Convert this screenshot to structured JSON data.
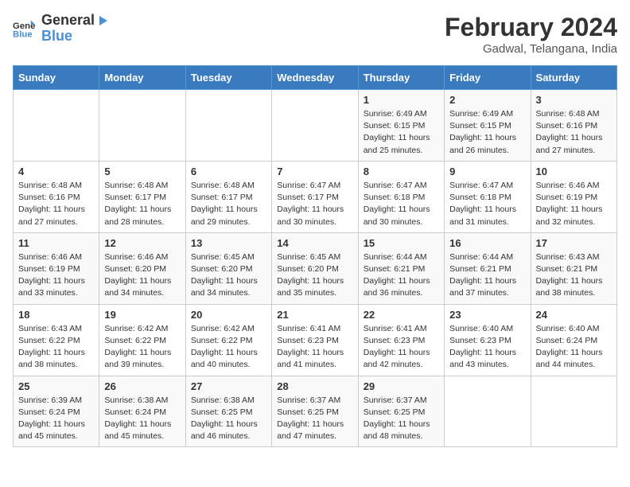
{
  "header": {
    "logo_general": "General",
    "logo_blue": "Blue",
    "title": "February 2024",
    "location": "Gadwal, Telangana, India"
  },
  "days_of_week": [
    "Sunday",
    "Monday",
    "Tuesday",
    "Wednesday",
    "Thursday",
    "Friday",
    "Saturday"
  ],
  "weeks": [
    [
      {
        "day": "",
        "info": ""
      },
      {
        "day": "",
        "info": ""
      },
      {
        "day": "",
        "info": ""
      },
      {
        "day": "",
        "info": ""
      },
      {
        "day": "1",
        "info": "Sunrise: 6:49 AM\nSunset: 6:15 PM\nDaylight: 11 hours and 25 minutes."
      },
      {
        "day": "2",
        "info": "Sunrise: 6:49 AM\nSunset: 6:15 PM\nDaylight: 11 hours and 26 minutes."
      },
      {
        "day": "3",
        "info": "Sunrise: 6:48 AM\nSunset: 6:16 PM\nDaylight: 11 hours and 27 minutes."
      }
    ],
    [
      {
        "day": "4",
        "info": "Sunrise: 6:48 AM\nSunset: 6:16 PM\nDaylight: 11 hours and 27 minutes."
      },
      {
        "day": "5",
        "info": "Sunrise: 6:48 AM\nSunset: 6:17 PM\nDaylight: 11 hours and 28 minutes."
      },
      {
        "day": "6",
        "info": "Sunrise: 6:48 AM\nSunset: 6:17 PM\nDaylight: 11 hours and 29 minutes."
      },
      {
        "day": "7",
        "info": "Sunrise: 6:47 AM\nSunset: 6:17 PM\nDaylight: 11 hours and 30 minutes."
      },
      {
        "day": "8",
        "info": "Sunrise: 6:47 AM\nSunset: 6:18 PM\nDaylight: 11 hours and 30 minutes."
      },
      {
        "day": "9",
        "info": "Sunrise: 6:47 AM\nSunset: 6:18 PM\nDaylight: 11 hours and 31 minutes."
      },
      {
        "day": "10",
        "info": "Sunrise: 6:46 AM\nSunset: 6:19 PM\nDaylight: 11 hours and 32 minutes."
      }
    ],
    [
      {
        "day": "11",
        "info": "Sunrise: 6:46 AM\nSunset: 6:19 PM\nDaylight: 11 hours and 33 minutes."
      },
      {
        "day": "12",
        "info": "Sunrise: 6:46 AM\nSunset: 6:20 PM\nDaylight: 11 hours and 34 minutes."
      },
      {
        "day": "13",
        "info": "Sunrise: 6:45 AM\nSunset: 6:20 PM\nDaylight: 11 hours and 34 minutes."
      },
      {
        "day": "14",
        "info": "Sunrise: 6:45 AM\nSunset: 6:20 PM\nDaylight: 11 hours and 35 minutes."
      },
      {
        "day": "15",
        "info": "Sunrise: 6:44 AM\nSunset: 6:21 PM\nDaylight: 11 hours and 36 minutes."
      },
      {
        "day": "16",
        "info": "Sunrise: 6:44 AM\nSunset: 6:21 PM\nDaylight: 11 hours and 37 minutes."
      },
      {
        "day": "17",
        "info": "Sunrise: 6:43 AM\nSunset: 6:21 PM\nDaylight: 11 hours and 38 minutes."
      }
    ],
    [
      {
        "day": "18",
        "info": "Sunrise: 6:43 AM\nSunset: 6:22 PM\nDaylight: 11 hours and 38 minutes."
      },
      {
        "day": "19",
        "info": "Sunrise: 6:42 AM\nSunset: 6:22 PM\nDaylight: 11 hours and 39 minutes."
      },
      {
        "day": "20",
        "info": "Sunrise: 6:42 AM\nSunset: 6:22 PM\nDaylight: 11 hours and 40 minutes."
      },
      {
        "day": "21",
        "info": "Sunrise: 6:41 AM\nSunset: 6:23 PM\nDaylight: 11 hours and 41 minutes."
      },
      {
        "day": "22",
        "info": "Sunrise: 6:41 AM\nSunset: 6:23 PM\nDaylight: 11 hours and 42 minutes."
      },
      {
        "day": "23",
        "info": "Sunrise: 6:40 AM\nSunset: 6:23 PM\nDaylight: 11 hours and 43 minutes."
      },
      {
        "day": "24",
        "info": "Sunrise: 6:40 AM\nSunset: 6:24 PM\nDaylight: 11 hours and 44 minutes."
      }
    ],
    [
      {
        "day": "25",
        "info": "Sunrise: 6:39 AM\nSunset: 6:24 PM\nDaylight: 11 hours and 45 minutes."
      },
      {
        "day": "26",
        "info": "Sunrise: 6:38 AM\nSunset: 6:24 PM\nDaylight: 11 hours and 45 minutes."
      },
      {
        "day": "27",
        "info": "Sunrise: 6:38 AM\nSunset: 6:25 PM\nDaylight: 11 hours and 46 minutes."
      },
      {
        "day": "28",
        "info": "Sunrise: 6:37 AM\nSunset: 6:25 PM\nDaylight: 11 hours and 47 minutes."
      },
      {
        "day": "29",
        "info": "Sunrise: 6:37 AM\nSunset: 6:25 PM\nDaylight: 11 hours and 48 minutes."
      },
      {
        "day": "",
        "info": ""
      },
      {
        "day": "",
        "info": ""
      }
    ]
  ]
}
